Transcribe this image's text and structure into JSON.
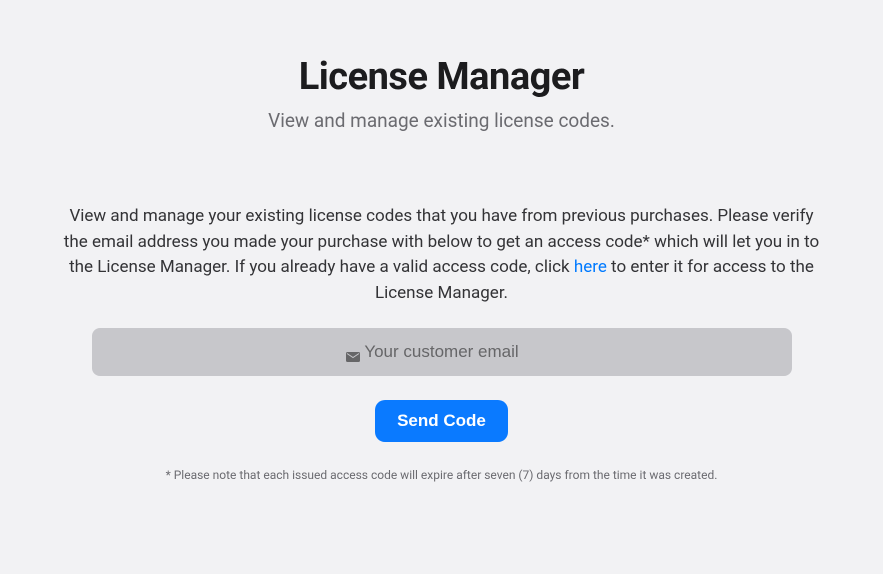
{
  "header": {
    "title": "License Manager",
    "subtitle": "View and manage existing license codes."
  },
  "body": {
    "description_prefix": "View and manage your existing license codes that you have from previous purchases. Please verify the email address you made your purchase with below to get an access code* which will let you in to the License Manager. If you already have a valid access code, click ",
    "description_link": "here",
    "description_suffix": " to enter it for access to the License Manager."
  },
  "form": {
    "email_placeholder": "Your customer email",
    "submit_label": "Send Code"
  },
  "footnote": "* Please note that each issued access code will expire after seven (7) days from the time it was created."
}
